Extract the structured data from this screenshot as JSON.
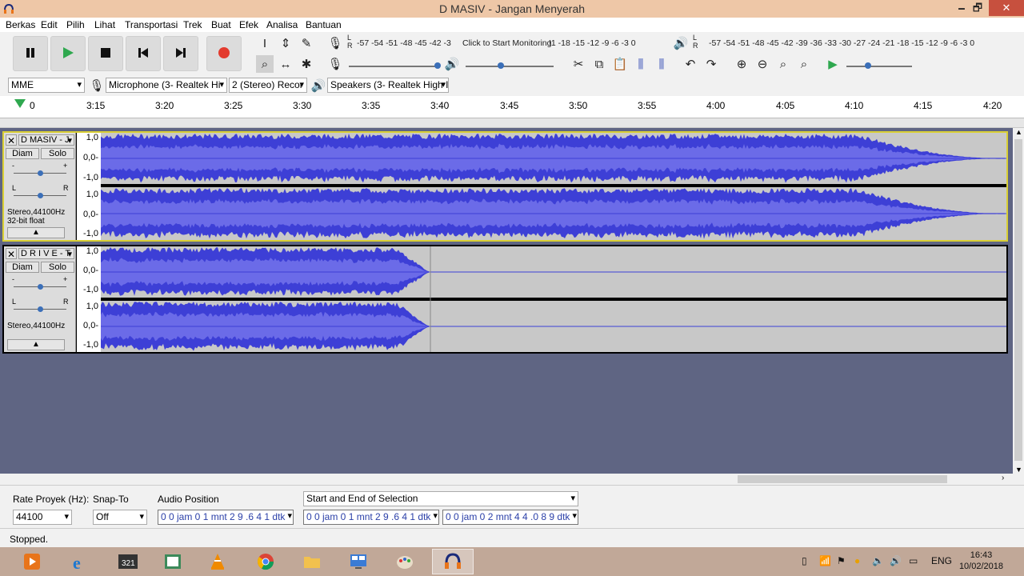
{
  "window": {
    "title": "D MASIV - Jangan Menyerah",
    "min": "🗕",
    "max": "🗗",
    "close": "✕"
  },
  "menu": [
    "Berkas",
    "Edit",
    "Pilih",
    "Lihat",
    "Transportasi",
    "Trek",
    "Buat",
    "Efek",
    "Analisa",
    "Bantuan"
  ],
  "transport": {
    "pause": "pause-icon",
    "play": "play-icon",
    "stop": "stop-icon",
    "skip_start": "skip-start-icon",
    "skip_end": "skip-end-icon",
    "record": "record-icon",
    "record_color": "#e33b2e",
    "play_color": "#2fa84f"
  },
  "meters": {
    "record_channels": "L\nR",
    "record_scale": "-57 -54 -51 -48 -45 -42 -3",
    "record_prompt": "Click to Start Monitoring",
    "record_scale_right": "!1 -18 -15 -12  -9  -6  -3  0",
    "play_channels": "L\nR",
    "play_scale": "-57 -54 -51 -48 -45 -42 -39 -36 -33 -30 -27 -24 -21 -18 -15 -12  -9  -6  -3  0"
  },
  "device": {
    "host": "MME",
    "mic": "Microphone (3- Realtek Hi",
    "channels": "2 (Stereo) Recor",
    "speakers": "Speakers (3- Realtek High I"
  },
  "ruler": [
    "0",
    "3:15",
    "3:20",
    "3:25",
    "3:30",
    "3:35",
    "3:40",
    "3:45",
    "3:50",
    "3:55",
    "4:00",
    "4:05",
    "4:10",
    "4:15",
    "4:20"
  ],
  "tracks": [
    {
      "name": "D MASIV - J",
      "mute": "Diam",
      "solo": "Solo",
      "gain_minus": "-",
      "gain_plus": "+",
      "pan_l": "L",
      "pan_r": "R",
      "info_rate": "Stereo,44100Hz",
      "info_format": "32-bit float",
      "scale_top": "1,0",
      "scale_mid": "0,0-",
      "scale_bot": "-1,0",
      "selected": true
    },
    {
      "name": "D R I V E - T",
      "mute": "Diam",
      "solo": "Solo",
      "gain_minus": "-",
      "gain_plus": "+",
      "pan_l": "L",
      "pan_r": "R",
      "info_rate": "Stereo,44100Hz",
      "info_format": "",
      "scale_top": "1,0",
      "scale_mid": "0,0-",
      "scale_bot": "-1,0",
      "selected": false
    }
  ],
  "selection_bar": {
    "rate_label": "Rate Proyek (Hz):",
    "rate_value": "44100",
    "snap_label": "Snap-To",
    "snap_value": "Off",
    "audio_pos_label": "Audio Position",
    "audio_pos_value": "0 0 jam 0 1 mnt 2 9 .6 4 1 dtk",
    "selection_mode": "Start and End of Selection",
    "sel_start": "0 0 jam 0 1 mnt 2 9 .6 4 1 dtk",
    "sel_end": "0 0 jam 0 2 mnt 4 4 .0 8 9 dtk"
  },
  "status": "Stopped.",
  "taskbar": {
    "apps": [
      "media-player-icon",
      "internet-explorer-icon",
      "video-editor-icon",
      "file-manager-icon",
      "vlc-icon",
      "chrome-icon",
      "explorer-folder-icon",
      "control-panel-icon",
      "paint-icon",
      "audacity-icon"
    ],
    "language": "ENG",
    "time": "16:43",
    "date": "10/02/2018"
  },
  "colors": {
    "waveform": "#3d3fd6",
    "waveform_rms": "#6b6be8",
    "track_bg": "#c8c8c8",
    "selected_border": "#d9cf35"
  }
}
